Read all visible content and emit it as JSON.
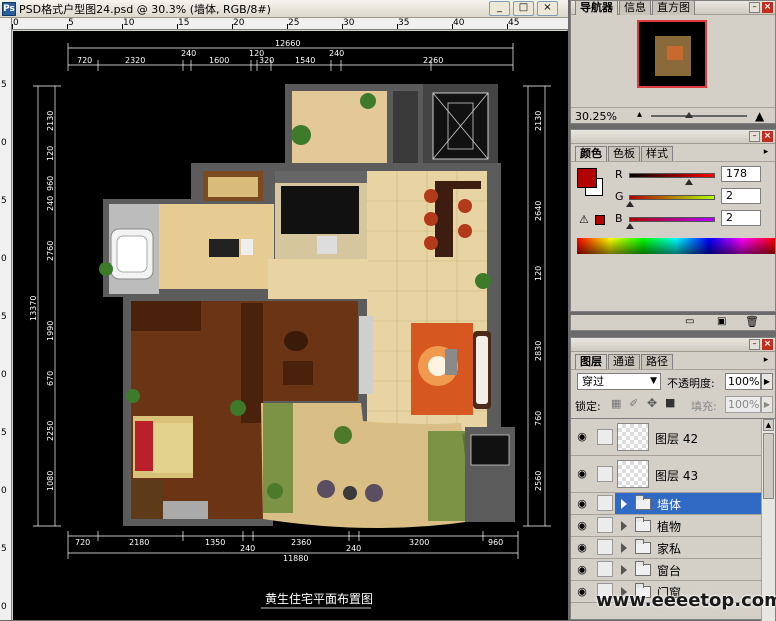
{
  "document": {
    "title": "PSD格式户型图24.psd @ 30.3% (墙体, RGB/8#)",
    "window_buttons": [
      "_",
      "□",
      "×"
    ],
    "ruler_top": [
      "0",
      "5",
      "10",
      "15",
      "20",
      "25",
      "30",
      "35",
      "40",
      "45"
    ],
    "ruler_left": [
      "5",
      "0",
      "5",
      "0",
      "5",
      "0",
      "5",
      "0",
      "5",
      "0",
      "5"
    ]
  },
  "plan": {
    "total_top": "12660",
    "top_dims": [
      "720",
      "2320",
      "240",
      "1600",
      "120",
      "320",
      "1540",
      "240",
      "2260"
    ],
    "bottom_dims": [
      "720",
      "2180",
      "1350",
      "240",
      "2360",
      "240",
      "3200",
      "960"
    ],
    "total_bottom": "11880",
    "left_dims": [
      "2130",
      "120",
      "960",
      "240",
      "2760",
      "1990",
      "670",
      "2250",
      "1080"
    ],
    "left_total": "13370",
    "right_dims": [
      "2130",
      "2640",
      "120",
      "2830",
      "760",
      "2560"
    ],
    "caption": "黄生住宅平面布置图"
  },
  "navigator": {
    "tabs": [
      "导航器",
      "信息",
      "直方图"
    ],
    "zoom": "30.25%"
  },
  "color": {
    "tabs": [
      "颜色",
      "色板",
      "样式"
    ],
    "channels": [
      {
        "label": "R",
        "value": "178",
        "fraction": 0.698
      },
      {
        "label": "G",
        "value": "2",
        "fraction": 0.008
      },
      {
        "label": "B",
        "value": "2",
        "fraction": 0.008
      }
    ],
    "foreground_color": "#b20202",
    "background_color": "#ffffff"
  },
  "layers": {
    "tabs": [
      "图层",
      "通道",
      "路径"
    ],
    "blend_mode": "穿过",
    "opacity_label": "不透明度:",
    "opacity_value": "100%",
    "lock_label": "锁定:",
    "fill_label": "填充:",
    "fill_value": "100%",
    "items": [
      {
        "name": "图层 42",
        "kind": "layer",
        "selected": false
      },
      {
        "name": "图层 43",
        "kind": "layer",
        "selected": false
      },
      {
        "name": "墙体",
        "kind": "group",
        "selected": true
      },
      {
        "name": "植物",
        "kind": "group",
        "selected": false
      },
      {
        "name": "家私",
        "kind": "group",
        "selected": false
      },
      {
        "name": "窗台",
        "kind": "group",
        "selected": false
      },
      {
        "name": "门窗",
        "kind": "group",
        "selected": false
      }
    ]
  },
  "watermark": "www.eeeetop.com",
  "colors": {
    "selection": "#316ac5",
    "accent_red": "#c03020"
  }
}
